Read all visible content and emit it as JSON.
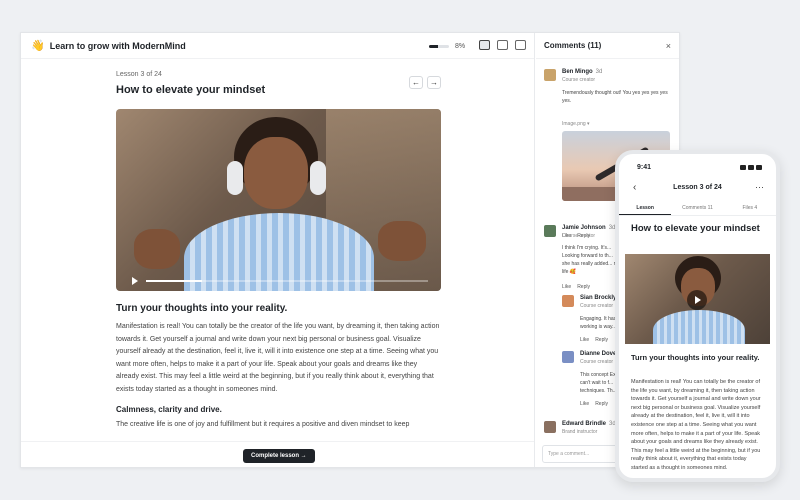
{
  "app": {
    "title": "Learn to grow with ModernMind",
    "progress_percent_label": "8%",
    "progress_value": 0.45
  },
  "lesson": {
    "counter": "Lesson 3 of 24",
    "title": "How to elevate your mindset",
    "prev_arrow": "←",
    "next_arrow": "→",
    "video_progress": 0.2,
    "section_heading": "Turn your thoughts into your reality.",
    "paragraph": "Manifestation is real! You can totally be the creator of the life you want, by dreaming it, then taking action towards it. Get yourself a journal and write down your next big personal or business goal. Visualize yourself already at the destination, feel it, live it, will it into existence one step at a time. Seeing what you want more often, helps to make it a part of your life. Speak about your goals and dreams like they already exist. This may feel a little weird at the beginning, but if you really think about it, everything that exists today started as a thought in someones mind.",
    "sub_heading": "Calmness, clarity and drive.",
    "paragraph2": "The creative life is one of joy and fulfillment but it requires a positive and diven mindset to keep",
    "complete_button": "Complete lesson →"
  },
  "comments": {
    "title": "Comments (11)",
    "close": "×",
    "input_placeholder": "Type a comment...",
    "items": [
      {
        "name": "Ben Mingo",
        "time": "3d",
        "role": "Course creator",
        "text": "Tremendously thought out! You yes yes yes yes yes.",
        "attachment_label": "Image.png ▾",
        "like": "Like",
        "reply": "Reply",
        "avatar_color": "#c9a36a"
      },
      {
        "name": "Jamie Johnson",
        "time": "3d",
        "role": "Course creator",
        "text": "I think I'm crying. It's... Looking forward to th... she has really added... my life 🥰",
        "like": "Like",
        "reply": "Reply",
        "avatar_color": "#5a7a5a"
      },
      {
        "name": "Sian Brockly",
        "time": "3d",
        "role": "Course creator",
        "text": "Engaging. It has... working is way...",
        "like": "Like",
        "reply": "Reply",
        "avatar_color": "#d48a5a"
      },
      {
        "name": "Dianne Dover",
        "time": "",
        "role": "Course creator",
        "text": "This concept Ex... can't wait to f... techniques. Th...",
        "like": "Like",
        "reply": "Reply",
        "avatar_color": "#7a8fc4"
      },
      {
        "name": "Edward Brindle",
        "time": "3d",
        "role": "Brand instructor",
        "text": "",
        "like": "",
        "reply": "",
        "avatar_color": "#8a7060"
      }
    ]
  },
  "phone": {
    "time": "9:41",
    "back": "‹",
    "title": "Lesson 3 of 24",
    "more": "···",
    "tabs": [
      "Lesson",
      "Comments 11",
      "Files 4"
    ],
    "heading": "How to elevate your mindset",
    "subheading": "Turn your thoughts into your reality.",
    "paragraph": "Manifestation is real! You can totally be the creator of the life you want, by dreaming it, then taking action towards it. Get yourself a journal and write down your next big personal or business goal. Visualize yourself already at the destination, feel it, live it, will it into existence one step at a time. Seeing what you want more often, helps to make it a part of your life. Speak about your goals and dreams like they already exist. This may feel a little weird at the beginning, but if you really think about it, everything that exists today started as a thought in someones mind."
  }
}
